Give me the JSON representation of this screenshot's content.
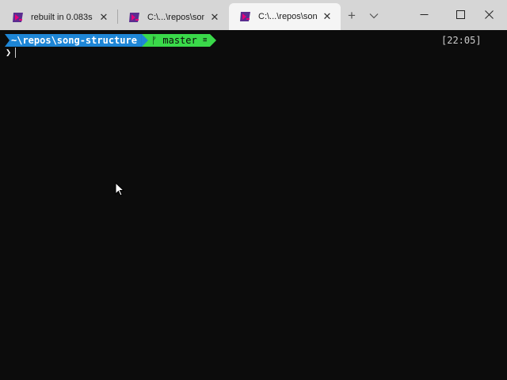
{
  "tabs": [
    {
      "title": "rebuilt in 0.083s",
      "icon": "powershell-icon",
      "active": false
    },
    {
      "title": "C:\\...\\repos\\song-",
      "icon": "powershell-icon",
      "active": false
    },
    {
      "title": "C:\\...\\repos\\song-",
      "icon": "powershell-icon",
      "active": true
    }
  ],
  "tabstrip": {
    "add_label": "+",
    "close_glyph": "✕"
  },
  "prompt": {
    "path": "~\\repos\\song-structure",
    "branch_glyph": "ᚠ",
    "branch": "master",
    "status_glyph": "≡",
    "time": "[22:05]",
    "input_symbol": "❯"
  },
  "colors": {
    "path_segment": "#1e86d6",
    "git_segment": "#3ad94a",
    "background": "#0c0c0c"
  }
}
